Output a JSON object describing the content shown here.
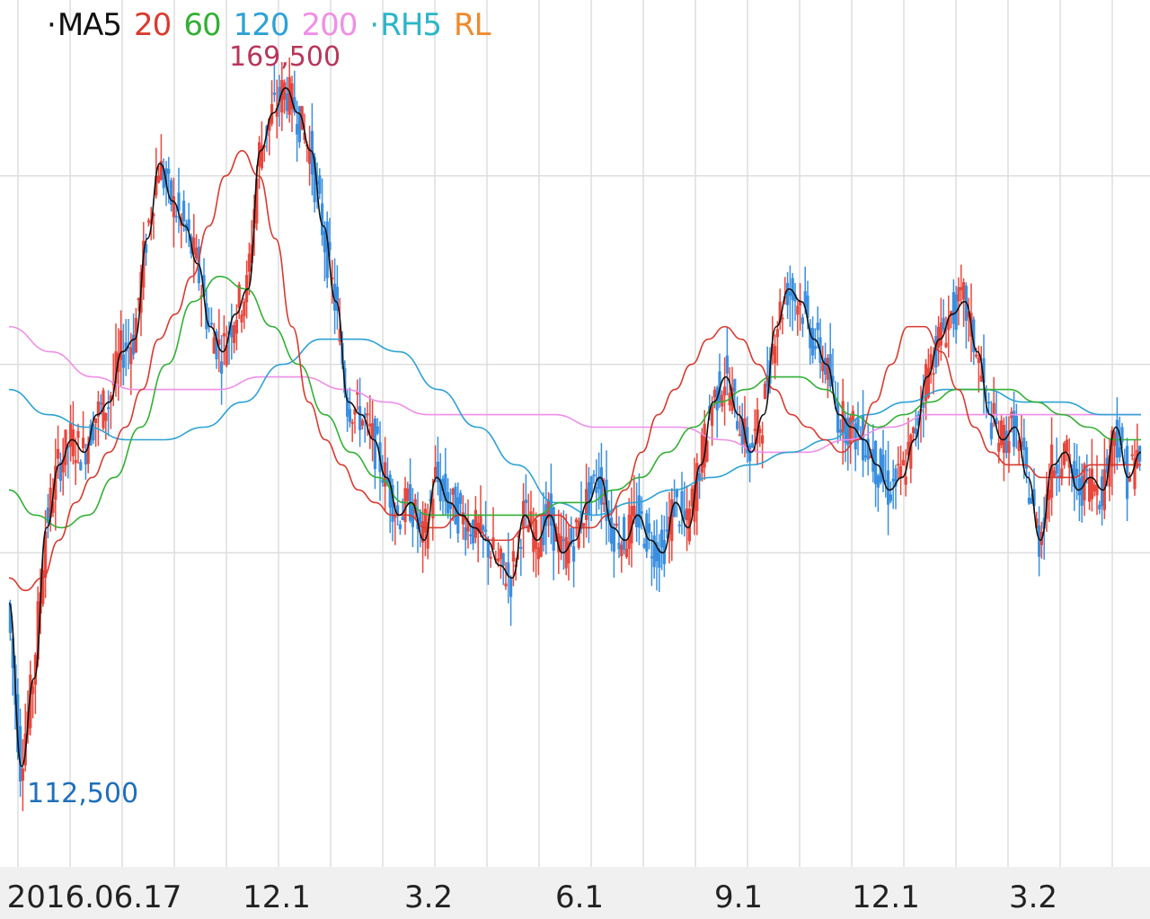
{
  "legend": {
    "ma_label": "MA5",
    "ma_periods": [
      "20",
      "60",
      "120",
      "200"
    ],
    "rh_label": "RH5",
    "rl_label": "RL"
  },
  "colors": {
    "background": "#ffffff",
    "grid": "#dddddd",
    "axis_band": "#f0f0f0",
    "up_candle": "#e8473c",
    "down_candle": "#3a8fe0",
    "ma5": "#111111",
    "ma20": "#d93a2f",
    "ma60": "#33b035",
    "ma120": "#2da2d6",
    "ma200": "#f08ee8",
    "rh5": "#2bb6c7",
    "rl": "#f08a2c",
    "high_label": "#b8365a",
    "low_label": "#1f6fb8"
  },
  "chart_data": {
    "type": "candlestick",
    "x_ticks": [
      "2016.06.17",
      "12.1",
      "3.2",
      "6.1",
      "9.1",
      "12.1",
      "3.2"
    ],
    "annotations": {
      "high": {
        "label": "169,500",
        "value": 169500
      },
      "low": {
        "label": "112,500",
        "value": 112500
      }
    },
    "y_gridlines": [
      160000,
      145000,
      130000
    ],
    "ylim": [
      105000,
      174000
    ],
    "grid": true,
    "close_series": [
      126000,
      113000,
      120000,
      132000,
      137000,
      139000,
      138000,
      141000,
      142000,
      146000,
      147000,
      155000,
      161000,
      158000,
      156000,
      153000,
      148000,
      146000,
      149000,
      151000,
      162000,
      165000,
      167000,
      165000,
      162000,
      156000,
      150000,
      142000,
      141000,
      139000,
      136000,
      133000,
      134000,
      131000,
      136000,
      134000,
      133000,
      132000,
      131000,
      129000,
      128000,
      133000,
      131000,
      133000,
      130000,
      131000,
      134000,
      136000,
      132000,
      131000,
      133000,
      131000,
      130000,
      134000,
      132000,
      137000,
      142000,
      144000,
      141000,
      138000,
      141000,
      148000,
      151000,
      150000,
      147000,
      145000,
      141000,
      140000,
      139000,
      137000,
      135000,
      136000,
      139000,
      144000,
      147000,
      149000,
      150000,
      146000,
      141000,
      139000,
      140000,
      136000,
      131000,
      137000,
      138000,
      135000,
      136000,
      135000,
      140000,
      136000,
      138000
    ],
    "ma20_series": [
      128000,
      127000,
      128000,
      131000,
      134000,
      136000,
      138000,
      140000,
      143000,
      147000,
      149000,
      152000,
      156000,
      160000,
      162000,
      160000,
      155000,
      148000,
      142000,
      139000,
      137000,
      135000,
      134000,
      133000,
      133000,
      132000,
      132000,
      133000,
      132000,
      131000,
      131000,
      132000,
      133000,
      133000,
      132000,
      132000,
      133000,
      135000,
      138000,
      141000,
      143000,
      145000,
      147000,
      148000,
      147000,
      145000,
      143000,
      141000,
      140000,
      139000,
      138000,
      139000,
      142000,
      145000,
      148000,
      148000,
      146000,
      143000,
      140000,
      138000,
      137000,
      137000,
      136000,
      136000,
      136000,
      137000,
      137000,
      137000,
      137000
    ],
    "ma60_series": [
      135000,
      133000,
      132000,
      133000,
      136000,
      140000,
      145000,
      150000,
      152000,
      151000,
      148000,
      145000,
      141000,
      138000,
      136000,
      134000,
      133000,
      133000,
      133000,
      133000,
      133000,
      134000,
      134000,
      135000,
      136000,
      138000,
      140000,
      142000,
      143000,
      144000,
      144000,
      143000,
      141000,
      140000,
      141000,
      142000,
      143000,
      143000,
      143000,
      142000,
      141000,
      140000,
      139000,
      139000
    ],
    "ma120_series": [
      143000,
      141000,
      140000,
      139000,
      139000,
      140000,
      142000,
      145000,
      147000,
      147000,
      146000,
      143000,
      140000,
      137000,
      134000,
      133000,
      134000,
      135000,
      136000,
      137000,
      138000,
      139000,
      141000,
      142000,
      143000,
      143000,
      142000,
      142000,
      141000,
      141000
    ],
    "ma200_series": [
      148000,
      146000,
      144000,
      143000,
      143000,
      143000,
      144000,
      144000,
      143000,
      142000,
      141000,
      141000,
      141000,
      141000,
      140000,
      140000,
      140000,
      139000,
      138000,
      138000,
      139000,
      140000,
      141000,
      141000,
      141000,
      141000,
      141000,
      141000
    ]
  }
}
